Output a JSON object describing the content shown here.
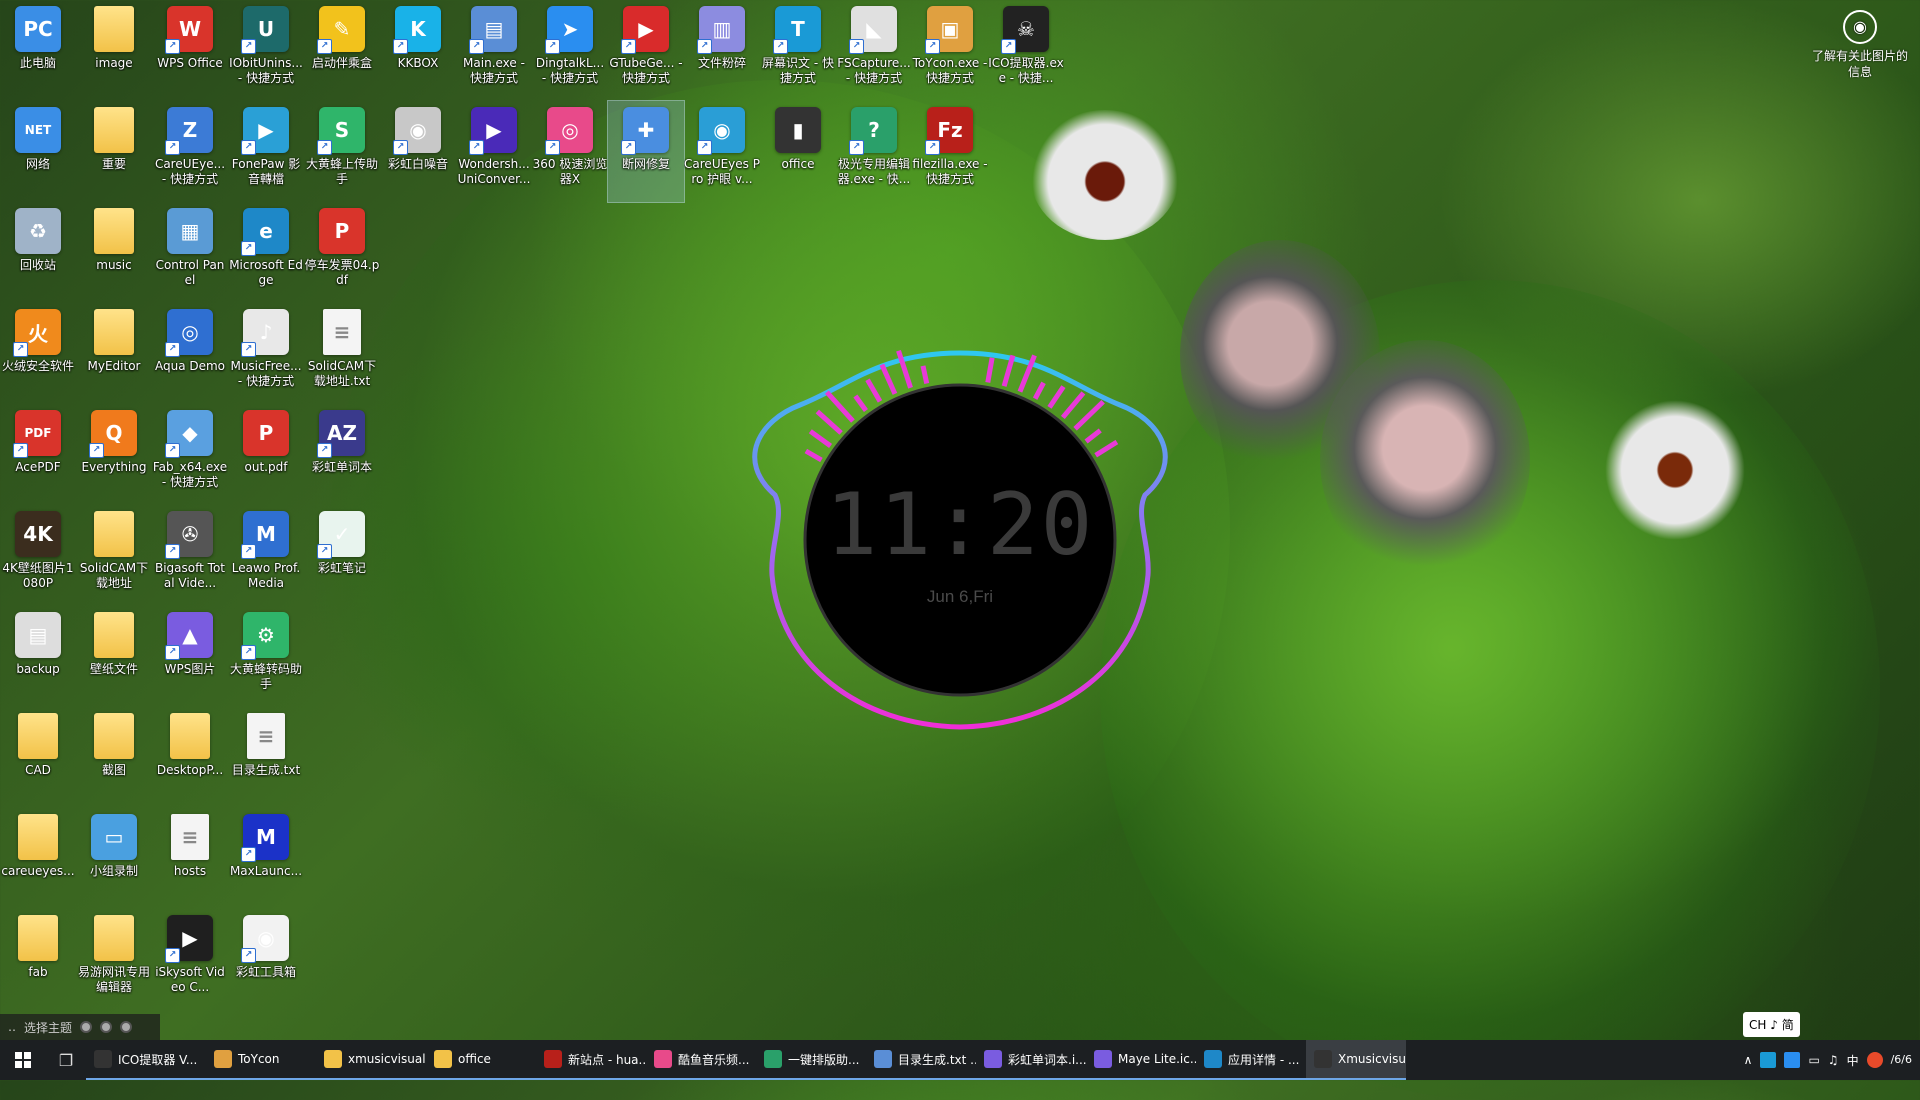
{
  "desktop": {
    "icons": [
      {
        "label": "此电脑",
        "color": "#3a8ee6",
        "kind": "app",
        "glyph": "PC",
        "shortcut": false
      },
      {
        "label": "网络",
        "color": "#3a8ee6",
        "kind": "app",
        "glyph": "NET",
        "shortcut": false
      },
      {
        "label": "回收站",
        "color": "#9fb3c8",
        "kind": "app",
        "glyph": "♻",
        "shortcut": false
      },
      {
        "label": "火绒安全软件",
        "color": "#f08a1c",
        "kind": "app",
        "glyph": "火",
        "shortcut": true
      },
      {
        "label": "AcePDF",
        "color": "#d9342b",
        "kind": "app",
        "glyph": "PDF",
        "shortcut": true
      },
      {
        "label": "4K壁纸图片1080P",
        "color": "#3b2d1e",
        "kind": "app",
        "glyph": "4K",
        "shortcut": false
      },
      {
        "label": "backup",
        "color": "#dddddd",
        "kind": "app",
        "glyph": "▤",
        "shortcut": false
      },
      {
        "label": "CAD",
        "color": "",
        "kind": "folder",
        "glyph": "",
        "shortcut": false
      },
      {
        "label": "careueyes...",
        "color": "",
        "kind": "folder",
        "glyph": "",
        "shortcut": false
      },
      {
        "label": "fab",
        "color": "",
        "kind": "folder",
        "glyph": "",
        "shortcut": false
      },
      {
        "label": "image",
        "color": "",
        "kind": "folder",
        "glyph": "",
        "shortcut": false
      },
      {
        "label": "重要",
        "color": "",
        "kind": "folder",
        "glyph": "",
        "shortcut": false
      },
      {
        "label": "music",
        "color": "",
        "kind": "folder",
        "glyph": "",
        "shortcut": false
      },
      {
        "label": "MyEditor",
        "color": "",
        "kind": "folder",
        "glyph": "",
        "shortcut": false
      },
      {
        "label": "Everything",
        "color": "#f07a1c",
        "kind": "app",
        "glyph": "Q",
        "shortcut": true
      },
      {
        "label": "SolidCAM下载地址",
        "color": "",
        "kind": "folder",
        "glyph": "",
        "shortcut": false
      },
      {
        "label": "壁纸文件",
        "color": "",
        "kind": "folder",
        "glyph": "",
        "shortcut": false
      },
      {
        "label": "截图",
        "color": "",
        "kind": "folder",
        "glyph": "",
        "shortcut": false
      },
      {
        "label": "小组录制",
        "color": "#4aa0e0",
        "kind": "app",
        "glyph": "▭",
        "shortcut": false
      },
      {
        "label": "易游网讯专用编辑器",
        "color": "",
        "kind": "folder",
        "glyph": "",
        "shortcut": false
      },
      {
        "label": "WPS Office",
        "color": "#d9342b",
        "kind": "app",
        "glyph": "W",
        "shortcut": true
      },
      {
        "label": "CareUEye... - 快捷方式",
        "color": "#3c7bd6",
        "kind": "app",
        "glyph": "Z",
        "shortcut": true
      },
      {
        "label": "Control Panel",
        "color": "#5a9bd5",
        "kind": "app",
        "glyph": "▦",
        "shortcut": false
      },
      {
        "label": "Aqua Demo",
        "color": "#2f6fd1",
        "kind": "app",
        "glyph": "◎",
        "shortcut": true
      },
      {
        "label": "Fab_x64.exe - 快捷方式",
        "color": "#5aa0e0",
        "kind": "app",
        "glyph": "◆",
        "shortcut": true
      },
      {
        "label": "Bigasoft Total Vide...",
        "color": "#555555",
        "kind": "app",
        "glyph": "✇",
        "shortcut": true
      },
      {
        "label": "WPS图片",
        "color": "#7a5ce0",
        "kind": "app",
        "glyph": "▲",
        "shortcut": true
      },
      {
        "label": "DesktopP...",
        "color": "",
        "kind": "folder",
        "glyph": "",
        "shortcut": false
      },
      {
        "label": "hosts",
        "color": "",
        "kind": "doc",
        "glyph": "",
        "shortcut": false
      },
      {
        "label": "iSkysoft Video C...",
        "color": "#1f1f1f",
        "kind": "app",
        "glyph": "▶",
        "shortcut": true
      },
      {
        "label": "IObitUnins... - 快捷方式",
        "color": "#1d6a6a",
        "kind": "app",
        "glyph": "U",
        "shortcut": true
      },
      {
        "label": "FonePaw 影音轉檔",
        "color": "#2aa0d6",
        "kind": "app",
        "glyph": "▶",
        "shortcut": true
      },
      {
        "label": "Microsoft Edge",
        "color": "#1e88c8",
        "kind": "app",
        "glyph": "e",
        "shortcut": true
      },
      {
        "label": "MusicFree... - 快捷方式",
        "color": "#e8e8e8",
        "kind": "app",
        "glyph": "♪",
        "shortcut": true
      },
      {
        "label": "out.pdf",
        "color": "#d9342b",
        "kind": "app",
        "glyph": "P",
        "shortcut": false
      },
      {
        "label": "Leawo Prof. Media",
        "color": "#2f6fd1",
        "kind": "app",
        "glyph": "M",
        "shortcut": true
      },
      {
        "label": "大黄蜂转码助手",
        "color": "#2fb56a",
        "kind": "app",
        "glyph": "⚙",
        "shortcut": true
      },
      {
        "label": "目录生成.txt",
        "color": "",
        "kind": "doc",
        "glyph": "",
        "shortcut": false
      },
      {
        "label": "MaxLaunc...",
        "color": "#1b32c8",
        "kind": "app",
        "glyph": "M",
        "shortcut": true
      },
      {
        "label": "彩虹工具箱",
        "color": "#f2f2f2",
        "kind": "app",
        "glyph": "◉",
        "shortcut": true
      },
      {
        "label": "启动伴乘盒",
        "color": "#f2c21c",
        "kind": "app",
        "glyph": "✎",
        "shortcut": true
      },
      {
        "label": "大黄蜂上传助手",
        "color": "#2fb56a",
        "kind": "app",
        "glyph": "S",
        "shortcut": true
      },
      {
        "label": "停车发票04.pdf",
        "color": "#d9342b",
        "kind": "app",
        "glyph": "P",
        "shortcut": false
      },
      {
        "label": "SolidCAM下载地址.txt",
        "color": "",
        "kind": "doc",
        "glyph": "",
        "shortcut": false
      },
      {
        "label": "彩虹单词本",
        "color": "#3a3a8c",
        "kind": "app",
        "glyph": "AZ",
        "shortcut": true
      },
      {
        "label": "彩虹笔记",
        "color": "#e8f4ee",
        "kind": "app",
        "glyph": "✓",
        "shortcut": true
      },
      {
        "label": "KKBOX",
        "color": "#19b2e8",
        "kind": "app",
        "glyph": "K",
        "shortcut": true
      },
      {
        "label": "彩虹白噪音",
        "color": "#c8c8c8",
        "kind": "app",
        "glyph": "◉",
        "shortcut": true
      },
      {
        "label": "Main.exe - 快捷方式",
        "color": "#5a8ed6",
        "kind": "app",
        "glyph": "▤",
        "shortcut": true
      },
      {
        "label": "Wondersh... UniConver...",
        "color": "#4a2ab8",
        "kind": "app",
        "glyph": "▶",
        "shortcut": true
      },
      {
        "label": "DingtalkL... - 快捷方式",
        "color": "#2a8ef0",
        "kind": "app",
        "glyph": "➤",
        "shortcut": true
      },
      {
        "label": "360 极速浏览器X",
        "color": "#e84a8a",
        "kind": "app",
        "glyph": "◎",
        "shortcut": true
      },
      {
        "label": "GTubeGe... - 快捷方式",
        "color": "#d92b2b",
        "kind": "app",
        "glyph": "▶",
        "shortcut": true
      },
      {
        "label": "断网修复",
        "color": "#4a8ee0",
        "kind": "app",
        "glyph": "✚",
        "shortcut": true
      },
      {
        "label": "文件粉碎",
        "color": "#8c8ce0",
        "kind": "app",
        "glyph": "▥",
        "shortcut": true
      },
      {
        "label": "CareUEyes Pro 护眼 v...",
        "color": "#2a9ed6",
        "kind": "app",
        "glyph": "◉",
        "shortcut": true
      },
      {
        "label": "屏幕识文 - 快捷方式",
        "color": "#1a9ad6",
        "kind": "app",
        "glyph": "T",
        "shortcut": true
      },
      {
        "label": "office",
        "color": "#333333",
        "kind": "app",
        "glyph": "▮",
        "shortcut": false
      },
      {
        "label": "FSCapture... - 快捷方式",
        "color": "#e0e0e0",
        "kind": "app",
        "glyph": "◣",
        "shortcut": true
      },
      {
        "label": "极光专用编辑器.exe - 快...",
        "color": "#2aa06a",
        "kind": "app",
        "glyph": "?",
        "shortcut": true
      },
      {
        "label": "ToYcon.exe - 快捷方式",
        "color": "#e0a040",
        "kind": "app",
        "glyph": "▣",
        "shortcut": true
      },
      {
        "label": "filezilla.exe - 快捷方式",
        "color": "#b8201a",
        "kind": "app",
        "glyph": "Fz",
        "shortcut": true
      },
      {
        "label": "ICO提取器.exe - 快捷...",
        "color": "#222222",
        "kind": "app",
        "glyph": "☠",
        "shortcut": true
      }
    ]
  },
  "visualizer": {
    "time": "11:20",
    "date": "Jun 6,Fri"
  },
  "learn_more": {
    "label": "了解有关此图片的信息",
    "icon": "camera-icon"
  },
  "theme_bar": {
    "label": "选择主题"
  },
  "ime_chip": {
    "label": "CH ♪ 简"
  },
  "taskbar": {
    "items": [
      {
        "label": "ICO提取器 V...",
        "color": "#333333",
        "active": false
      },
      {
        "label": "ToYcon",
        "color": "#e0a040",
        "active": false
      },
      {
        "label": "xmusicvisual...",
        "color": "#f2c248",
        "active": false
      },
      {
        "label": "office",
        "color": "#f2c248",
        "active": false
      },
      {
        "label": "新站点 - hua...",
        "color": "#b8201a",
        "active": false
      },
      {
        "label": "酷鱼音乐频...",
        "color": "#e84a8a",
        "active": false
      },
      {
        "label": "一键排版助...",
        "color": "#2aa06a",
        "active": false
      },
      {
        "label": "目录生成.txt ...",
        "color": "#5a8ed6",
        "active": false
      },
      {
        "label": "彩虹单词本.i...",
        "color": "#7a5ce0",
        "active": false
      },
      {
        "label": "Maye Lite.ic...",
        "color": "#7a5ce0",
        "active": false
      },
      {
        "label": "应用详情 - ...",
        "color": "#1e88c8",
        "active": false
      },
      {
        "label": "Xmusicvisua...",
        "color": "#333333",
        "active": true
      }
    ],
    "tray": {
      "ime": "中",
      "date_line": "/6/6"
    }
  },
  "colors": {
    "taskbar_bg": "#1c1f22",
    "ring_cyan": "#2ec8f0",
    "ring_magenta": "#f02ed8"
  }
}
